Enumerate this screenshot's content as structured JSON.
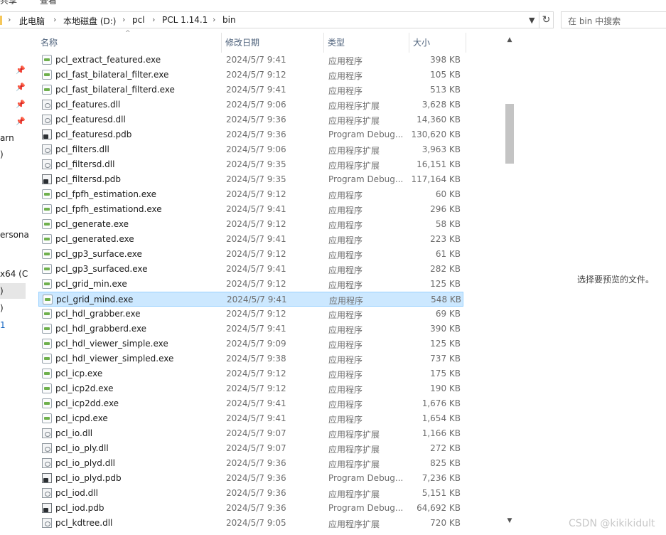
{
  "ribbon": {
    "item_a": "共享",
    "item_b": "查看"
  },
  "address": {
    "crumbs": [
      "此电脑",
      "本地磁盘 (D:)",
      "pcl",
      "PCL 1.14.1",
      "bin"
    ],
    "search_placeholder": "在 bin 中搜索"
  },
  "nav": {
    "fragments": [
      "arn",
      ")",
      "ersona",
      "x64 (C",
      ")",
      ")",
      "1"
    ]
  },
  "columns": {
    "name": "名称",
    "date": "修改日期",
    "type": "类型",
    "size": "大小"
  },
  "files": [
    {
      "name": "pcl_extract_featured.exe",
      "date": "2024/5/7 9:41",
      "type": "应用程序",
      "size": "398 KB",
      "icon": "exe"
    },
    {
      "name": "pcl_fast_bilateral_filter.exe",
      "date": "2024/5/7 9:12",
      "type": "应用程序",
      "size": "105 KB",
      "icon": "exe"
    },
    {
      "name": "pcl_fast_bilateral_filterd.exe",
      "date": "2024/5/7 9:41",
      "type": "应用程序",
      "size": "513 KB",
      "icon": "exe"
    },
    {
      "name": "pcl_features.dll",
      "date": "2024/5/7 9:06",
      "type": "应用程序扩展",
      "size": "3,628 KB",
      "icon": "dll"
    },
    {
      "name": "pcl_featuresd.dll",
      "date": "2024/5/7 9:36",
      "type": "应用程序扩展",
      "size": "14,360 KB",
      "icon": "dll"
    },
    {
      "name": "pcl_featuresd.pdb",
      "date": "2024/5/7 9:36",
      "type": "Program Debug...",
      "size": "130,620 KB",
      "icon": "pdb"
    },
    {
      "name": "pcl_filters.dll",
      "date": "2024/5/7 9:06",
      "type": "应用程序扩展",
      "size": "3,963 KB",
      "icon": "dll"
    },
    {
      "name": "pcl_filtersd.dll",
      "date": "2024/5/7 9:35",
      "type": "应用程序扩展",
      "size": "16,151 KB",
      "icon": "dll"
    },
    {
      "name": "pcl_filtersd.pdb",
      "date": "2024/5/7 9:35",
      "type": "Program Debug...",
      "size": "117,164 KB",
      "icon": "pdb"
    },
    {
      "name": "pcl_fpfh_estimation.exe",
      "date": "2024/5/7 9:12",
      "type": "应用程序",
      "size": "60 KB",
      "icon": "exe"
    },
    {
      "name": "pcl_fpfh_estimationd.exe",
      "date": "2024/5/7 9:41",
      "type": "应用程序",
      "size": "296 KB",
      "icon": "exe"
    },
    {
      "name": "pcl_generate.exe",
      "date": "2024/5/7 9:12",
      "type": "应用程序",
      "size": "58 KB",
      "icon": "exe"
    },
    {
      "name": "pcl_generated.exe",
      "date": "2024/5/7 9:41",
      "type": "应用程序",
      "size": "223 KB",
      "icon": "exe"
    },
    {
      "name": "pcl_gp3_surface.exe",
      "date": "2024/5/7 9:12",
      "type": "应用程序",
      "size": "61 KB",
      "icon": "exe"
    },
    {
      "name": "pcl_gp3_surfaced.exe",
      "date": "2024/5/7 9:41",
      "type": "应用程序",
      "size": "282 KB",
      "icon": "exe"
    },
    {
      "name": "pcl_grid_min.exe",
      "date": "2024/5/7 9:12",
      "type": "应用程序",
      "size": "125 KB",
      "icon": "exe"
    },
    {
      "name": "pcl_grid_mind.exe",
      "date": "2024/5/7 9:41",
      "type": "应用程序",
      "size": "548 KB",
      "icon": "exe",
      "selected": true
    },
    {
      "name": "pcl_hdl_grabber.exe",
      "date": "2024/5/7 9:12",
      "type": "应用程序",
      "size": "69 KB",
      "icon": "exe"
    },
    {
      "name": "pcl_hdl_grabberd.exe",
      "date": "2024/5/7 9:41",
      "type": "应用程序",
      "size": "390 KB",
      "icon": "exe"
    },
    {
      "name": "pcl_hdl_viewer_simple.exe",
      "date": "2024/5/7 9:09",
      "type": "应用程序",
      "size": "125 KB",
      "icon": "exe"
    },
    {
      "name": "pcl_hdl_viewer_simpled.exe",
      "date": "2024/5/7 9:38",
      "type": "应用程序",
      "size": "737 KB",
      "icon": "exe"
    },
    {
      "name": "pcl_icp.exe",
      "date": "2024/5/7 9:12",
      "type": "应用程序",
      "size": "175 KB",
      "icon": "exe"
    },
    {
      "name": "pcl_icp2d.exe",
      "date": "2024/5/7 9:12",
      "type": "应用程序",
      "size": "190 KB",
      "icon": "exe"
    },
    {
      "name": "pcl_icp2dd.exe",
      "date": "2024/5/7 9:41",
      "type": "应用程序",
      "size": "1,676 KB",
      "icon": "exe"
    },
    {
      "name": "pcl_icpd.exe",
      "date": "2024/5/7 9:41",
      "type": "应用程序",
      "size": "1,654 KB",
      "icon": "exe"
    },
    {
      "name": "pcl_io.dll",
      "date": "2024/5/7 9:07",
      "type": "应用程序扩展",
      "size": "1,166 KB",
      "icon": "dll"
    },
    {
      "name": "pcl_io_ply.dll",
      "date": "2024/5/7 9:07",
      "type": "应用程序扩展",
      "size": "272 KB",
      "icon": "dll"
    },
    {
      "name": "pcl_io_plyd.dll",
      "date": "2024/5/7 9:36",
      "type": "应用程序扩展",
      "size": "825 KB",
      "icon": "dll"
    },
    {
      "name": "pcl_io_plyd.pdb",
      "date": "2024/5/7 9:36",
      "type": "Program Debug...",
      "size": "7,236 KB",
      "icon": "pdb"
    },
    {
      "name": "pcl_iod.dll",
      "date": "2024/5/7 9:36",
      "type": "应用程序扩展",
      "size": "5,151 KB",
      "icon": "dll"
    },
    {
      "name": "pcl_iod.pdb",
      "date": "2024/5/7 9:36",
      "type": "Program Debug...",
      "size": "64,692 KB",
      "icon": "pdb"
    },
    {
      "name": "pcl_kdtree.dll",
      "date": "2024/5/7 9:05",
      "type": "应用程序扩展",
      "size": "720 KB",
      "icon": "dll"
    }
  ],
  "preview": {
    "message": "选择要预览的文件。"
  },
  "watermark": "CSDN @kikikidult"
}
